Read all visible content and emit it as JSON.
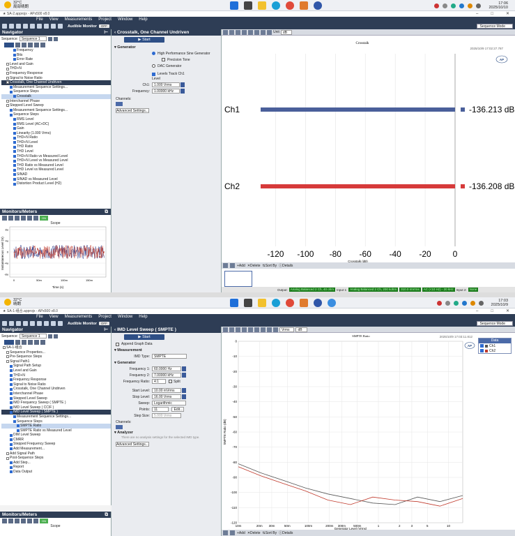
{
  "top": {
    "taskbar": {
      "temperature": "32°C",
      "weather": "局部晴朗",
      "time": "17:06",
      "date": "2025/10/10"
    },
    "app_title": "★ SA-2.approjx - APx500 v8.0",
    "menu": [
      "File",
      "View",
      "Measurements",
      "Project",
      "Window",
      "Help"
    ],
    "audible_monitor_label": "Audible Monitor",
    "audible_monitor_state": "OFF",
    "sequence_mode": "Sequence Mode",
    "navigator": {
      "title": "Navigator",
      "sequence_label": "Sequence:",
      "sequence_value": "Sequence 1",
      "items": [
        {
          "label": "Frequency",
          "indent": 3
        },
        {
          "label": "Bits",
          "indent": 3
        },
        {
          "label": "Error Rate",
          "indent": 3
        },
        {
          "label": "Level and Gain",
          "indent": 1
        },
        {
          "label": "THD+N",
          "indent": 1
        },
        {
          "label": "Frequency Response",
          "indent": 1
        },
        {
          "label": "Signal to Noise Ratio",
          "indent": 1
        },
        {
          "label": "Crosstalk, One Channel Undriven",
          "indent": 1,
          "state": "hl"
        },
        {
          "label": "Measurement Sequence Settings...",
          "indent": 2
        },
        {
          "label": "Sequence Steps",
          "indent": 2
        },
        {
          "label": "Crosstalk",
          "indent": 3,
          "state": "sel"
        },
        {
          "label": "Interchannel Phase",
          "indent": 1
        },
        {
          "label": "Stepped Level Sweep",
          "indent": 1
        },
        {
          "label": "Measurement Sequence Settings...",
          "indent": 2
        },
        {
          "label": "Sequence Steps",
          "indent": 2
        },
        {
          "label": "RMS Level",
          "indent": 3
        },
        {
          "label": "RMS Level (AC+DC)",
          "indent": 3
        },
        {
          "label": "Gain",
          "indent": 3
        },
        {
          "label": "Linearity (1.000 Vrms)",
          "indent": 3
        },
        {
          "label": "THD+N Ratio",
          "indent": 3
        },
        {
          "label": "THD+N Level",
          "indent": 3
        },
        {
          "label": "THD Ratio",
          "indent": 3
        },
        {
          "label": "THD Level",
          "indent": 3
        },
        {
          "label": "THD+N Ratio vs Measured Level",
          "indent": 3
        },
        {
          "label": "THD+N Level vs Measured Level",
          "indent": 3
        },
        {
          "label": "THD Ratio vs Measured Level",
          "indent": 3
        },
        {
          "label": "THD Level vs Measured Level",
          "indent": 3
        },
        {
          "label": "SINAD",
          "indent": 3
        },
        {
          "label": "SINAD vs Measured Level",
          "indent": 3
        },
        {
          "label": "Distortion Product Level (H2)",
          "indent": 3
        }
      ]
    },
    "monitors": {
      "title": "Monitors/Meters",
      "scope_title": "Scope",
      "ylabel": "Instantaneous Level (V)",
      "xlabel": "Time (s)",
      "xticks": [
        "0",
        "50m",
        "100m",
        "150m"
      ],
      "yticks": [
        "8u",
        "4u",
        "0",
        "-4u",
        "-8u"
      ],
      "on_label": "ON"
    },
    "settings": {
      "title": "Crosstalk, One Channel Undriven",
      "start_label": "Start",
      "generator_label": "Generator",
      "radio_options": [
        {
          "label": "High Performance Sine Generator",
          "selected": true
        },
        {
          "label": "Precision Tone",
          "selected": false
        },
        {
          "label": "DAC Generator",
          "selected": false
        }
      ],
      "levels_track_label": "Levels Track Ch1",
      "level_label": "Level",
      "ch1_label": "Ch1:",
      "ch1_value": "1.000 Vrms",
      "frequency_label": "Frequency:",
      "frequency_value": "1.00000 kHz",
      "channels_label": "Channels:",
      "advanced_label": "Advanced Settings..."
    },
    "graph": {
      "unit_label": "Unit",
      "unit_value": "dB",
      "title": "Crosstalk",
      "timestamp": "2025/10/9 17:02:27.787",
      "logo": "AP",
      "xlabel": "Crosstalk (dB)",
      "add_label": "Add",
      "delete_label": "Delete",
      "sort_label": "Sort By",
      "details_label": "Details",
      "thumb_label": "Crosstalk"
    },
    "chart_data": {
      "type": "bar",
      "title": "Crosstalk",
      "xlabel": "Crosstalk (dB)",
      "xlim": [
        -130,
        0
      ],
      "xticks": [
        -120,
        -100,
        -80,
        -60,
        -40,
        -20,
        0
      ],
      "categories": [
        "Ch1",
        "Ch2"
      ],
      "values": [
        -136.213,
        -136.208
      ],
      "value_labels": [
        "-136.213 dB",
        "-136.208 dB"
      ],
      "colors": [
        "#4a5f9a",
        "#d63a3a"
      ]
    },
    "status": {
      "output_label": "Output:",
      "output_value": "Analog Balanced 2 Ch, 40 ohm",
      "input1_label": "Input 1:",
      "input1_value": "Analog Balanced 2 Ch, 200 kohm",
      "range_value": "310.0 mVrms",
      "ac_value": "AC (<10 Hz) - 20 kHz",
      "input2_label": "Input 2:",
      "input2_value": "None"
    }
  },
  "bottom": {
    "taskbar": {
      "temperature": "32°C",
      "weather": "晴朗",
      "time": "17:03",
      "date": "2025/10/9"
    },
    "app_title": "★ SA-1-组合.approjx - APx500 v8.0",
    "menu": [
      "File",
      "View",
      "Measurements",
      "Project",
      "Window",
      "Help"
    ],
    "audible_monitor_label": "Audible Monitor",
    "audible_monitor_state": "OFF",
    "sequence_mode": "Sequence Mode",
    "navigator": {
      "title": "Navigator",
      "sequence_label": "Sequence:",
      "sequence_value": "Sequence 1",
      "items": [
        {
          "label": "SA-1-组合",
          "indent": 0
        },
        {
          "label": "Sequence Properties...",
          "indent": 1
        },
        {
          "label": "Pre-Sequence Steps",
          "indent": 1
        },
        {
          "label": "Signal Path1",
          "indent": 1
        },
        {
          "label": "Signal Path Setup",
          "indent": 2
        },
        {
          "label": "Level and Gain",
          "indent": 2
        },
        {
          "label": "THD+N",
          "indent": 2
        },
        {
          "label": "Frequency Response",
          "indent": 2
        },
        {
          "label": "Signal to Noise Ratio",
          "indent": 2
        },
        {
          "label": "Crosstalk, One Channel Undriven",
          "indent": 2
        },
        {
          "label": "Interchannel Phase",
          "indent": 2
        },
        {
          "label": "Stepped Level Sweep",
          "indent": 2
        },
        {
          "label": "IMD Frequency Sweep ( SMPTE )",
          "indent": 2
        },
        {
          "label": "IMD Level Sweep ( CCIF )",
          "indent": 2
        },
        {
          "label": "IMD Level Sweep ( SMPTE )",
          "indent": 2,
          "state": "hl"
        },
        {
          "label": "Measurement Sequence Settings...",
          "indent": 3
        },
        {
          "label": "Sequence Steps",
          "indent": 3
        },
        {
          "label": "SMPTE Ratio",
          "indent": 4,
          "state": "sel"
        },
        {
          "label": "SMPTE Ratio vs Measured Level",
          "indent": 4
        },
        {
          "label": "DIM Level Sweep",
          "indent": 2
        },
        {
          "label": "CMRR",
          "indent": 2
        },
        {
          "label": "Stepped Frequency Sweep",
          "indent": 2
        },
        {
          "label": "Add Measurement...",
          "indent": 2
        },
        {
          "label": "Add Signal Path",
          "indent": 1
        },
        {
          "label": "Post-Sequence Steps",
          "indent": 1
        },
        {
          "label": "Add Step...",
          "indent": 2
        },
        {
          "label": "Report",
          "indent": 2
        },
        {
          "label": "Data Output",
          "indent": 2
        }
      ]
    },
    "monitors": {
      "title": "Monitors/Meters",
      "scope_title": "Scope",
      "on_label": "ON"
    },
    "settings": {
      "title": "IMD Level Sweep ( SMPTE )",
      "start_label": "Start",
      "append_label": "Append Graph Data",
      "measurement_label": "Measurement",
      "imd_type_label": "IMD Type:",
      "imd_type_value": "SMPTE",
      "generator_label": "Generator",
      "freq1_label": "Frequency 1:",
      "freq1_value": "60.0000 Hz",
      "freq2_label": "Frequency 2:",
      "freq2_value": "7.00000 kHz",
      "ratio_label": "Frequency Ratio:",
      "ratio_value": "4:1",
      "split_label": "Split",
      "start_level_label": "Start Level:",
      "start_level_value": "10.00 mVrms",
      "stop_level_label": "Stop Level:",
      "stop_level_value": "16.00 Vrms",
      "sweep_label": "Sweep:",
      "sweep_value": "Logarithmic",
      "points_label": "Points:",
      "points_value": "11",
      "edit_label": "Edit...",
      "step_label": "Step Size:",
      "step_value": "5.000 Vrms",
      "channels_label": "Channels:",
      "analyzer_label": "Analyzer",
      "analyzer_note": "There are no analysis settings for the selected IMD type.",
      "advanced_label": "Advanced Settings..."
    },
    "graph": {
      "unit_value": "Vrms",
      "unit2_value": "dB",
      "title": "SMPTE Ratio",
      "timestamp": "2025/10/9 17:03:11.812",
      "logo": "AP",
      "legend_title": "Data",
      "add_label": "Add",
      "delete_label": "Delete",
      "sort_label": "Sort By",
      "details_label": "Details"
    },
    "chart_data": {
      "type": "line",
      "title": "SMPTE Ratio",
      "xlabel": "Generator Level (Vrms)",
      "ylabel": "SMPTE Ratio (dB)",
      "xscale": "log",
      "xlim": [
        0.01,
        16
      ],
      "ylim": [
        -120,
        0
      ],
      "xticks": [
        "10m",
        "20m",
        "30m",
        "50m",
        "100m",
        "200m",
        "300m",
        "500m",
        "1",
        "2",
        "3",
        "5",
        "10"
      ],
      "xtick_values": [
        0.01,
        0.02,
        0.03,
        0.05,
        0.1,
        0.2,
        0.3,
        0.5,
        1,
        2,
        3,
        5,
        10
      ],
      "yticks": [
        0,
        -10,
        -20,
        -30,
        -40,
        -50,
        -60,
        -70,
        -80,
        -90,
        -100,
        -110,
        -120
      ],
      "series": [
        {
          "name": "Ch1",
          "color": "#555555",
          "x": [
            0.01,
            0.0209,
            0.0437,
            0.0912,
            0.19,
            0.398,
            0.83,
            1.73,
            3.62,
            7.56,
            16
          ],
          "y": [
            -81,
            -87,
            -92,
            -97,
            -101,
            -104,
            -107,
            -108,
            -103,
            -106,
            -102
          ]
        },
        {
          "name": "Ch2",
          "color": "#c0392b",
          "x": [
            0.01,
            0.0209,
            0.0437,
            0.0912,
            0.19,
            0.398,
            0.83,
            1.73,
            3.62,
            7.56,
            16
          ],
          "y": [
            -83,
            -89,
            -94,
            -99,
            -105,
            -108,
            -103,
            -105,
            -106,
            -109,
            -104
          ]
        }
      ]
    }
  }
}
